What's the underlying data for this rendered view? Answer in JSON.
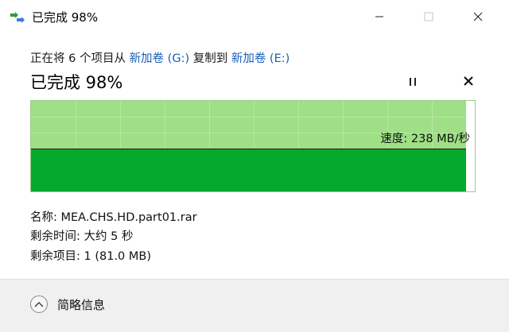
{
  "titlebar": {
    "title": "已完成 98%"
  },
  "header": {
    "from_prefix": "正在将 6 个项目从 ",
    "source": "新加卷 (G:)",
    "mid": " 复制到 ",
    "destination": "新加卷 (E:)",
    "status": "已完成 98%"
  },
  "graph": {
    "speed_label": "速度: 238 MB/秒",
    "progress_percent": 98
  },
  "info": {
    "name_label": "名称: ",
    "name_value": "MEA.CHS.HD.part01.rar",
    "time_label": "剩余时间: ",
    "time_value": "大约 5 秒",
    "items_label": "剩余项目: ",
    "items_value": "1 (81.0 MB)"
  },
  "footer": {
    "less_details": "简略信息"
  },
  "icons": {
    "app": "copy-arrows-icon",
    "minimize": "minimize-icon",
    "maximize": "maximize-icon",
    "close": "close-icon",
    "pause": "pause-icon",
    "cancel": "cancel-icon",
    "collapse": "chevron-up-icon"
  },
  "colors": {
    "graph_background": "#9fdf86",
    "graph_fill": "#04a82a",
    "link": "#1a5fb4"
  }
}
